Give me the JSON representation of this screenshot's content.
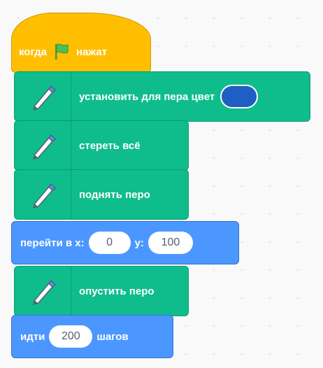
{
  "blocks": {
    "when_flag": {
      "prefix": "когда",
      "suffix": "нажат",
      "icon": "green-flag-icon"
    },
    "set_pen_color": {
      "label": "установить для пера цвет",
      "icon": "pen-icon",
      "color_value": "#1f5fc4"
    },
    "clear": {
      "label": "стереть всё",
      "icon": "pen-icon"
    },
    "pen_up": {
      "label": "поднять перо",
      "icon": "pen-icon"
    },
    "goto_xy": {
      "label": "перейти в x:",
      "x_value": "0",
      "y_label": "y:",
      "y_value": "100"
    },
    "pen_down": {
      "label": "опустить перо",
      "icon": "pen-icon"
    },
    "move": {
      "label": "идти",
      "steps_value": "200",
      "suffix": "шагов"
    }
  },
  "colors": {
    "events": "#ffbf00",
    "pen": "#0fbd8c",
    "motion": "#4c97ff",
    "pen_color_swatch": "#1f5fc4"
  }
}
